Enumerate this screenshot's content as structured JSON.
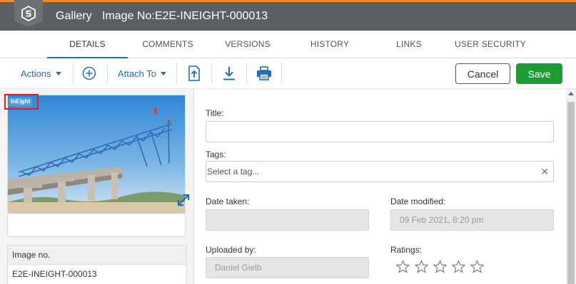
{
  "header": {
    "section": "Gallery",
    "title": "Image No:E2E-INEIGHT-000013"
  },
  "tabs": [
    "DETAILS",
    "COMMENTS",
    "VERSIONS",
    "HISTORY",
    "LINKS",
    "USER SECURITY"
  ],
  "active_tab": "DETAILS",
  "toolbar": {
    "actions_label": "Actions",
    "attach_label": "Attach To",
    "cancel_label": "Cancel",
    "save_label": "Save",
    "icons": [
      "add-circle-icon",
      "upload-file-icon",
      "download-icon",
      "print-icon"
    ]
  },
  "image_panel": {
    "badge": "InEight",
    "table_header": "Image no.",
    "table_value": "E2E-INEIGHT-000013"
  },
  "form": {
    "title_label": "Title:",
    "title_value": "",
    "tags_label": "Tags:",
    "tags_placeholder": "Select a tag...",
    "date_taken_label": "Date taken:",
    "date_taken_value": "",
    "date_modified_label": "Date modified:",
    "date_modified_value": "09 Feb 2021, 8:20 pm",
    "uploaded_by_label": "Uploaded by:",
    "uploaded_by_value": "Daniel Gielb",
    "ratings_label": "Ratings:",
    "rating_value": 0,
    "rating_max": 5
  },
  "colors": {
    "accent": "#1a6fb5",
    "save": "#1d9b35",
    "header_bg": "#5b5f62",
    "header_stripe": "#f28b25",
    "highlight": "#e21b23"
  }
}
